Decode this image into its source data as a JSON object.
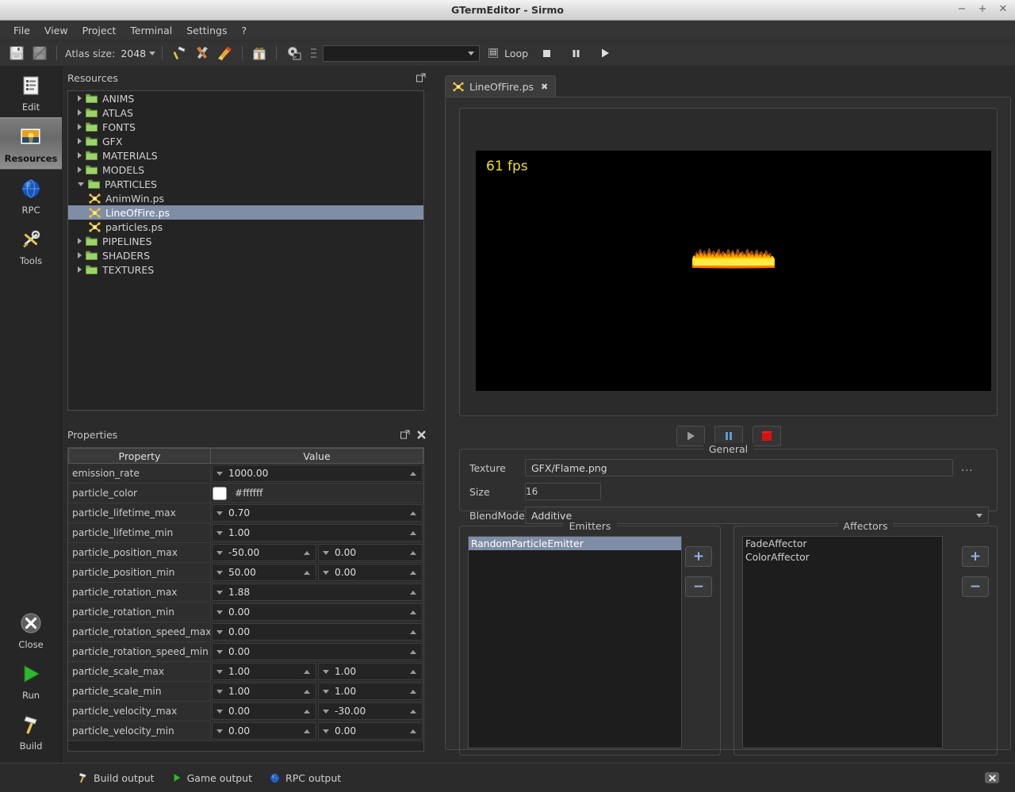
{
  "window": {
    "title": "GTermEditor - Sirmo",
    "controls": {
      "minimize": "−",
      "maximize": "+",
      "close": "✕"
    }
  },
  "menubar": {
    "items": [
      {
        "label": "File",
        "name": "menu-file"
      },
      {
        "label": "View",
        "name": "menu-view"
      },
      {
        "label": "Project",
        "name": "menu-project"
      },
      {
        "label": "Terminal",
        "name": "menu-terminal"
      },
      {
        "label": "Settings",
        "name": "menu-settings"
      },
      {
        "label": "?",
        "name": "menu-help"
      }
    ]
  },
  "toolbar": {
    "atlas_label": "Atlas size:",
    "atlas_value": "2048",
    "combo_value": "",
    "loop_label": "Loop",
    "loop_checked": true,
    "icons": {
      "save": "save-icon",
      "save_all": "save-all-icon",
      "build": "hammer-icon",
      "rebuild": "hammers-icon",
      "clean": "broom-icon",
      "package": "package-icon",
      "terminal": "gear-terminal-icon",
      "stop": "stop-icon",
      "pause": "pause-icon",
      "play": "play-icon"
    }
  },
  "sidebar": {
    "top_items": [
      {
        "label": "Edit",
        "icon": "document-edit-icon",
        "active": false
      },
      {
        "label": "Resources",
        "icon": "image-resource-icon",
        "active": true
      },
      {
        "label": "RPC",
        "icon": "globe-icon",
        "active": false
      },
      {
        "label": "Tools",
        "icon": "tools-icon",
        "active": false
      }
    ],
    "bottom_items": [
      {
        "label": "Close",
        "icon": "close-circle-icon"
      },
      {
        "label": "Run",
        "icon": "run-play-icon"
      },
      {
        "label": "Build",
        "icon": "hammer-icon"
      }
    ]
  },
  "resources": {
    "title": "Resources",
    "float_icon": "undock-icon",
    "tree": [
      {
        "label": "ANIMS",
        "type": "folder",
        "expanded": false
      },
      {
        "label": "ATLAS",
        "type": "folder",
        "expanded": false
      },
      {
        "label": "FONTS",
        "type": "folder",
        "expanded": false
      },
      {
        "label": "GFX",
        "type": "folder",
        "expanded": false
      },
      {
        "label": "MATERIALS",
        "type": "folder",
        "expanded": false
      },
      {
        "label": "MODELS",
        "type": "folder",
        "expanded": false
      },
      {
        "label": "PARTICLES",
        "type": "folder",
        "expanded": true
      },
      {
        "label": "AnimWin.ps",
        "type": "file",
        "selected": false
      },
      {
        "label": "LineOfFire.ps",
        "type": "file",
        "selected": true
      },
      {
        "label": "particles.ps",
        "type": "file",
        "selected": false
      },
      {
        "label": "PIPELINES",
        "type": "folder",
        "expanded": false
      },
      {
        "label": "SHADERS",
        "type": "folder",
        "expanded": false
      },
      {
        "label": "TEXTURES",
        "type": "folder",
        "expanded": false
      }
    ]
  },
  "properties": {
    "title": "Properties",
    "float_icon": "undock-icon",
    "close_icon": "close-icon",
    "columns": [
      "Property",
      "Value"
    ],
    "rows": [
      {
        "name": "emission_rate",
        "kind": "spin1",
        "v1": "1000.00"
      },
      {
        "name": "particle_color",
        "kind": "color",
        "swatch": "#ffffff",
        "hex": "#ffffff"
      },
      {
        "name": "particle_lifetime_max",
        "kind": "spin1",
        "v1": "0.70"
      },
      {
        "name": "particle_lifetime_min",
        "kind": "spin1",
        "v1": "1.00"
      },
      {
        "name": "particle_position_max",
        "kind": "spin2",
        "v1": "-50.00",
        "v2": "0.00"
      },
      {
        "name": "particle_position_min",
        "kind": "spin2",
        "v1": "50.00",
        "v2": "0.00"
      },
      {
        "name": "particle_rotation_max",
        "kind": "spin1",
        "v1": "1.88"
      },
      {
        "name": "particle_rotation_min",
        "kind": "spin1",
        "v1": "0.00"
      },
      {
        "name": "particle_rotation_speed_max",
        "kind": "spin1",
        "v1": "0.00"
      },
      {
        "name": "particle_rotation_speed_min",
        "kind": "spin1",
        "v1": "0.00"
      },
      {
        "name": "particle_scale_max",
        "kind": "spin2",
        "v1": "1.00",
        "v2": "1.00"
      },
      {
        "name": "particle_scale_min",
        "kind": "spin2",
        "v1": "1.00",
        "v2": "1.00"
      },
      {
        "name": "particle_velocity_max",
        "kind": "spin2",
        "v1": "0.00",
        "v2": "-30.00"
      },
      {
        "name": "particle_velocity_min",
        "kind": "spin2",
        "v1": "0.00",
        "v2": "0.00"
      }
    ]
  },
  "editor": {
    "tab": {
      "label": "LineOfFire.ps",
      "icon": "particle-icon",
      "close": "✖"
    },
    "preview": {
      "fps": "61 fps",
      "effect": "line-of-fire-particles"
    },
    "playback": [
      {
        "name": "play-button",
        "icon": "play-icon"
      },
      {
        "name": "pause-button",
        "icon": "pause-icon"
      },
      {
        "name": "stop-button",
        "icon": "stop-icon"
      }
    ],
    "general": {
      "title": "General",
      "texture_label": "Texture",
      "texture_value": "GFX/Flame.png",
      "browse_label": "...",
      "size_label": "Size",
      "size_value": "16",
      "blendmode_label": "BlendMode",
      "blendmode_value": "Additive"
    },
    "emitters": {
      "title": "Emitters",
      "items": [
        {
          "label": "RandomParticleEmitter",
          "selected": true
        }
      ],
      "add_label": "+",
      "remove_label": "−"
    },
    "affectors": {
      "title": "Affectors",
      "items": [
        {
          "label": "FadeAffector",
          "selected": false
        },
        {
          "label": "ColorAffector",
          "selected": false
        }
      ],
      "add_label": "+",
      "remove_label": "−"
    }
  },
  "statusbar": {
    "items": [
      {
        "label": "Build output",
        "icon": "hammer-icon"
      },
      {
        "label": "Game output",
        "icon": "play-icon"
      },
      {
        "label": "RPC output",
        "icon": "globe-icon"
      }
    ],
    "close_icon": "close-icon"
  },
  "colors": {
    "selection": "#7f8ea6",
    "fps_text": "#f2e500",
    "accent_blue": "#8fb6e0",
    "flame_core": "#ffe800",
    "flame_mid": "#ff9000",
    "flame_edge": "#d01000"
  }
}
